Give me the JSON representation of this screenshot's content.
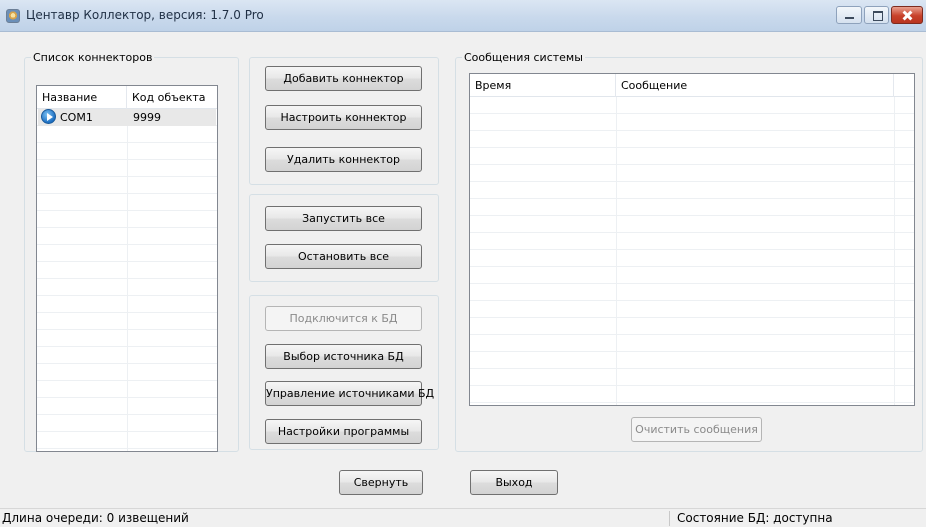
{
  "window": {
    "title": "Центавр Коллектор, версия: 1.7.0 Pro",
    "icon": "app-icon",
    "controls": [
      "minimize",
      "maximize",
      "close"
    ]
  },
  "connectors": {
    "group_label": "Список коннекторов",
    "columns": [
      "Название",
      "Код объекта"
    ],
    "rows": [
      {
        "name": "COM1",
        "code": "9999",
        "icon": "play-circle-icon",
        "selected": true
      }
    ]
  },
  "actions": {
    "connector_buttons": [
      "Добавить коннектор",
      "Настроить коннектор",
      "Удалить коннектор"
    ],
    "run_buttons": [
      "Запустить все",
      "Остановить все"
    ],
    "db_buttons": [
      {
        "label": "Подключится к БД",
        "enabled": false
      },
      {
        "label": "Выбор источника БД",
        "enabled": true
      },
      {
        "label": "Управление источниками БД",
        "enabled": true
      },
      {
        "label": "Настройки программы",
        "enabled": true
      }
    ]
  },
  "messages": {
    "group_label": "Сообщения системы",
    "columns": [
      "Время",
      "Сообщение"
    ],
    "rows": [],
    "clear_button": {
      "label": "Очистить сообщения",
      "enabled": false
    }
  },
  "footer": {
    "minimize_button": "Свернуть",
    "exit_button": "Выход"
  },
  "statusbar": {
    "queue": "Длина очереди: 0 извещений",
    "db_state": "Состояние БД: доступна"
  },
  "colors": {
    "close_button": "#c8412a",
    "selected_row": "#e8e8e8",
    "status_icon": "#1d6fc2"
  }
}
